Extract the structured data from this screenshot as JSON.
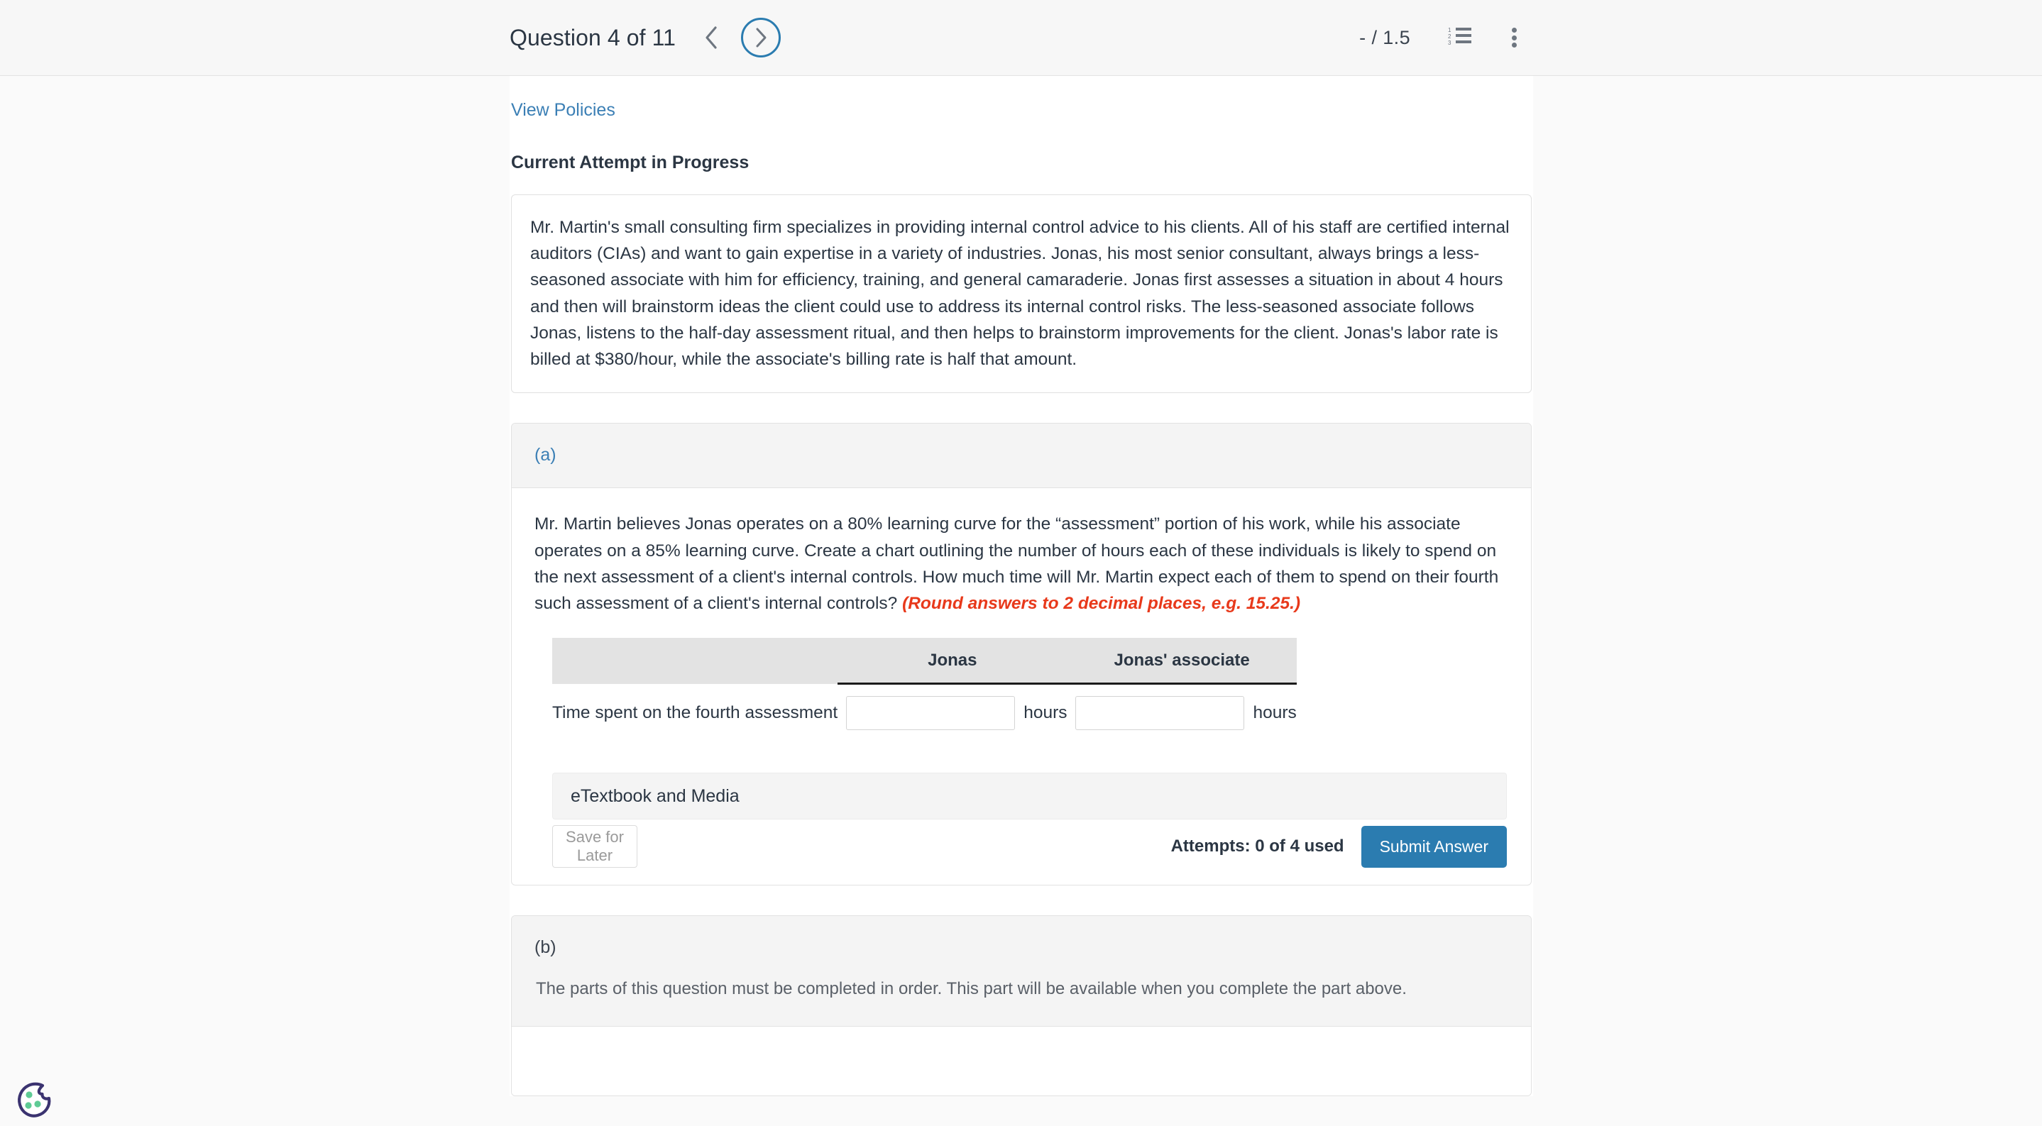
{
  "header": {
    "question_title": "Question 4 of 11",
    "prev_icon": "chevron-left-icon",
    "next_icon": "chevron-right-icon",
    "score": "- / 1.5",
    "list_icon": "numbered-list-icon",
    "more_icon": "kebab-menu-icon"
  },
  "links": {
    "view_policies": "View Policies"
  },
  "attempt": {
    "heading": "Current Attempt in Progress",
    "scenario": "Mr. Martin's small consulting firm specializes in providing internal control advice to his clients. All of his staff are certified internal auditors (CIAs) and want to gain expertise in a variety of industries. Jonas, his most senior consultant, always brings a less-seasoned associate with him for efficiency, training, and general camaraderie. Jonas first assesses a situation in about 4 hours and then will brainstorm ideas the client could use to address its internal control risks. The less-seasoned associate follows Jonas, listens to the half-day assessment ritual, and then helps to brainstorm improvements for the client. Jonas's labor rate is billed at $380/hour, while the associate's billing rate is half that amount."
  },
  "part_a": {
    "label": "(a)",
    "question": "Mr. Martin believes Jonas operates on a 80% learning curve for the “assessment” portion of his work, while his associate operates on a 85% learning curve. Create a chart outlining the number of hours each of these individuals is likely to spend on the next assessment of a client's internal controls. How much time will Mr. Martin expect each of them to spend on their fourth such assessment of a client's internal controls?",
    "round_note": "(Round answers to 2 decimal places, e.g. 15.25.)",
    "table": {
      "headers": [
        "",
        "Jonas",
        "Jonas' associate"
      ],
      "rows": [
        {
          "label": "Time spent on the fourth assessment",
          "jonas_value": "",
          "jonas_placeholder": "",
          "jonas_unit": "hours",
          "associate_value": "",
          "associate_placeholder": "",
          "associate_unit": "hours"
        }
      ]
    },
    "etextbook_label": "eTextbook and Media",
    "save_label": "Save for Later",
    "attempts_label": "Attempts: 0 of 4 used",
    "submit_label": "Submit Answer"
  },
  "part_b": {
    "label": "(b)",
    "locked_message": "The parts of this question must be completed in order. This part will be available when you complete the part above."
  },
  "cookie": {
    "icon": "cookie-consent-icon"
  },
  "colors": {
    "accent_blue": "#2b7cb0",
    "link_blue": "#3b7fb5",
    "alert_red": "#e8391b",
    "text_dark": "#2b3643",
    "header_bg": "#f7f7f7",
    "panel_gray": "#f4f4f4",
    "table_header_gray": "#e3e3e3"
  }
}
